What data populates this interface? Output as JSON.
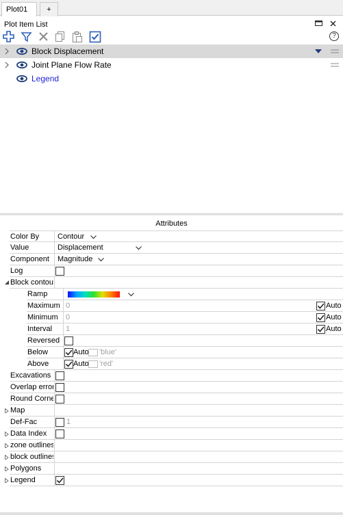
{
  "tabs": [
    {
      "label": "Plot01"
    },
    {
      "label": "+"
    }
  ],
  "plot_item_list": {
    "title": "Plot Item List",
    "items": [
      {
        "label": "Block Displacement",
        "selected": true
      },
      {
        "label": "Joint Plane Flow Rate",
        "selected": false
      },
      {
        "label": "Legend",
        "selected": false
      }
    ]
  },
  "toolbar": {
    "icons": [
      "add-icon",
      "filter-icon",
      "delete-icon",
      "copy-icon",
      "paste-icon",
      "checkbox-icon"
    ],
    "help": "?"
  },
  "attributes": {
    "title": "Attributes",
    "color_by": {
      "label": "Color By",
      "value": "Contour"
    },
    "value": {
      "label": "Value",
      "value": "Displacement"
    },
    "component": {
      "label": "Component",
      "value": "Magnitude"
    },
    "log": {
      "label": "Log",
      "checked": false
    },
    "block_contour": {
      "label": "Block contour",
      "ramp": {
        "label": "Ramp"
      },
      "maximum": {
        "label": "Maximum",
        "value": "0",
        "auto_label": "Auto",
        "auto": true
      },
      "minimum": {
        "label": "Minimum",
        "value": "0",
        "auto_label": "Auto",
        "auto": true
      },
      "interval": {
        "label": "Interval",
        "value": "1",
        "auto_label": "Auto",
        "auto": true
      },
      "reversed": {
        "label": "Reversed",
        "checked": false
      },
      "below": {
        "label": "Below",
        "auto_label": "Auto",
        "auto": true,
        "color": "'blue'"
      },
      "above": {
        "label": "Above",
        "auto_label": "Auto",
        "auto": true,
        "color": "'red'"
      }
    },
    "excavations": {
      "label": "Excavations",
      "checked": false
    },
    "overlap_error": {
      "label": "Overlap error",
      "checked": false
    },
    "round_corners": {
      "label": "Round Corners",
      "checked": false
    },
    "map": {
      "label": "Map"
    },
    "def_fac": {
      "label": "Def-Fac",
      "checked": false,
      "value": "1"
    },
    "data_index": {
      "label": "Data Index",
      "checked": false
    },
    "zone_outlines": {
      "label": "zone outlines"
    },
    "block_outlines": {
      "label": "block outlines"
    },
    "polygons": {
      "label": "Polygons"
    },
    "legend": {
      "label": "Legend",
      "checked": true
    }
  },
  "colors": {
    "selected_row": "#d9d9d9",
    "link": "#1f1fd2",
    "icon_blue": "#2b5db8"
  }
}
